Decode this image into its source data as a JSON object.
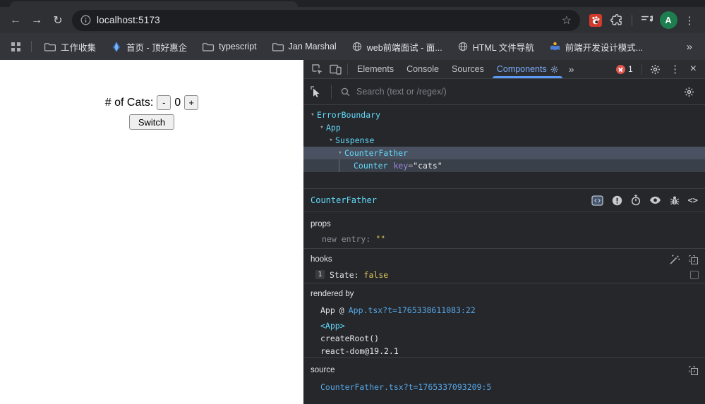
{
  "browser": {
    "toolbar": {
      "back_icon": "←",
      "forward_icon": "→",
      "reload_icon": "↻",
      "url": "localhost:5173",
      "star_icon": "☆",
      "avatar_letter": "A",
      "menu_icon": "⋮"
    },
    "bookmarks": {
      "items": [
        {
          "label": "工作收集",
          "icon": "folder-icon"
        },
        {
          "label": "首页 - 顶好惠企",
          "icon": "blue-gem-favicon"
        },
        {
          "label": "typescript",
          "icon": "folder-icon"
        },
        {
          "label": "Jan Marshal",
          "icon": "folder-icon"
        },
        {
          "label": "web前端面试 - 面...",
          "icon": "globe-favicon"
        },
        {
          "label": "HTML 文件导航",
          "icon": "globe-favicon"
        },
        {
          "label": "前端开发设计模式...",
          "icon": "reader-favicon"
        }
      ],
      "overflow_icon": "»"
    }
  },
  "page": {
    "cats_label": "# of Cats:",
    "minus_button": "-",
    "count_value": "0",
    "plus_button": "+",
    "switch_button": "Switch"
  },
  "devtools": {
    "tabs": [
      {
        "label": "Elements"
      },
      {
        "label": "Console"
      },
      {
        "label": "Sources"
      },
      {
        "label": "Components"
      }
    ],
    "more_tabs_icon": "»",
    "error_count": "1",
    "menu_icon": "⋮",
    "close_icon": "×",
    "search_placeholder": "Search (text or /regex/)",
    "tree": {
      "arrow": "▾",
      "items": [
        {
          "name": "ErrorBoundary"
        },
        {
          "name": "App"
        },
        {
          "name": "Suspense"
        },
        {
          "name": "CounterFather"
        },
        {
          "name": "Counter",
          "key_name": "key",
          "key_eq": "=",
          "key_value": "\"cats\""
        }
      ]
    },
    "detail": {
      "title": "CounterFather",
      "code_icon": "<>",
      "props": {
        "header": "props",
        "key": "new entry:",
        "value": "\"\""
      },
      "hooks": {
        "header": "hooks",
        "index": "1",
        "name": "State:",
        "value": "false"
      },
      "rendered_by": {
        "header": "rendered by",
        "owner": "App",
        "at_sign": "@",
        "owner_link": "App.tsx?t=1765338611083:22",
        "row2": "<App>",
        "row3": "createRoot()",
        "row4": "react-dom@19.2.1"
      },
      "source": {
        "header": "source",
        "link": "CounterFather.tsx?t=1765337093209:5"
      }
    }
  },
  "colors": {
    "accent_blue": "#7cacf8",
    "react_cyan": "#61dafb",
    "value_yellow": "#dcc65a",
    "link_blue": "#56a8e8",
    "error_red": "#e0564d",
    "avatar_green": "#1d7e4f",
    "extension_red": "#d23b2b",
    "selected_row": "#4a5160"
  }
}
